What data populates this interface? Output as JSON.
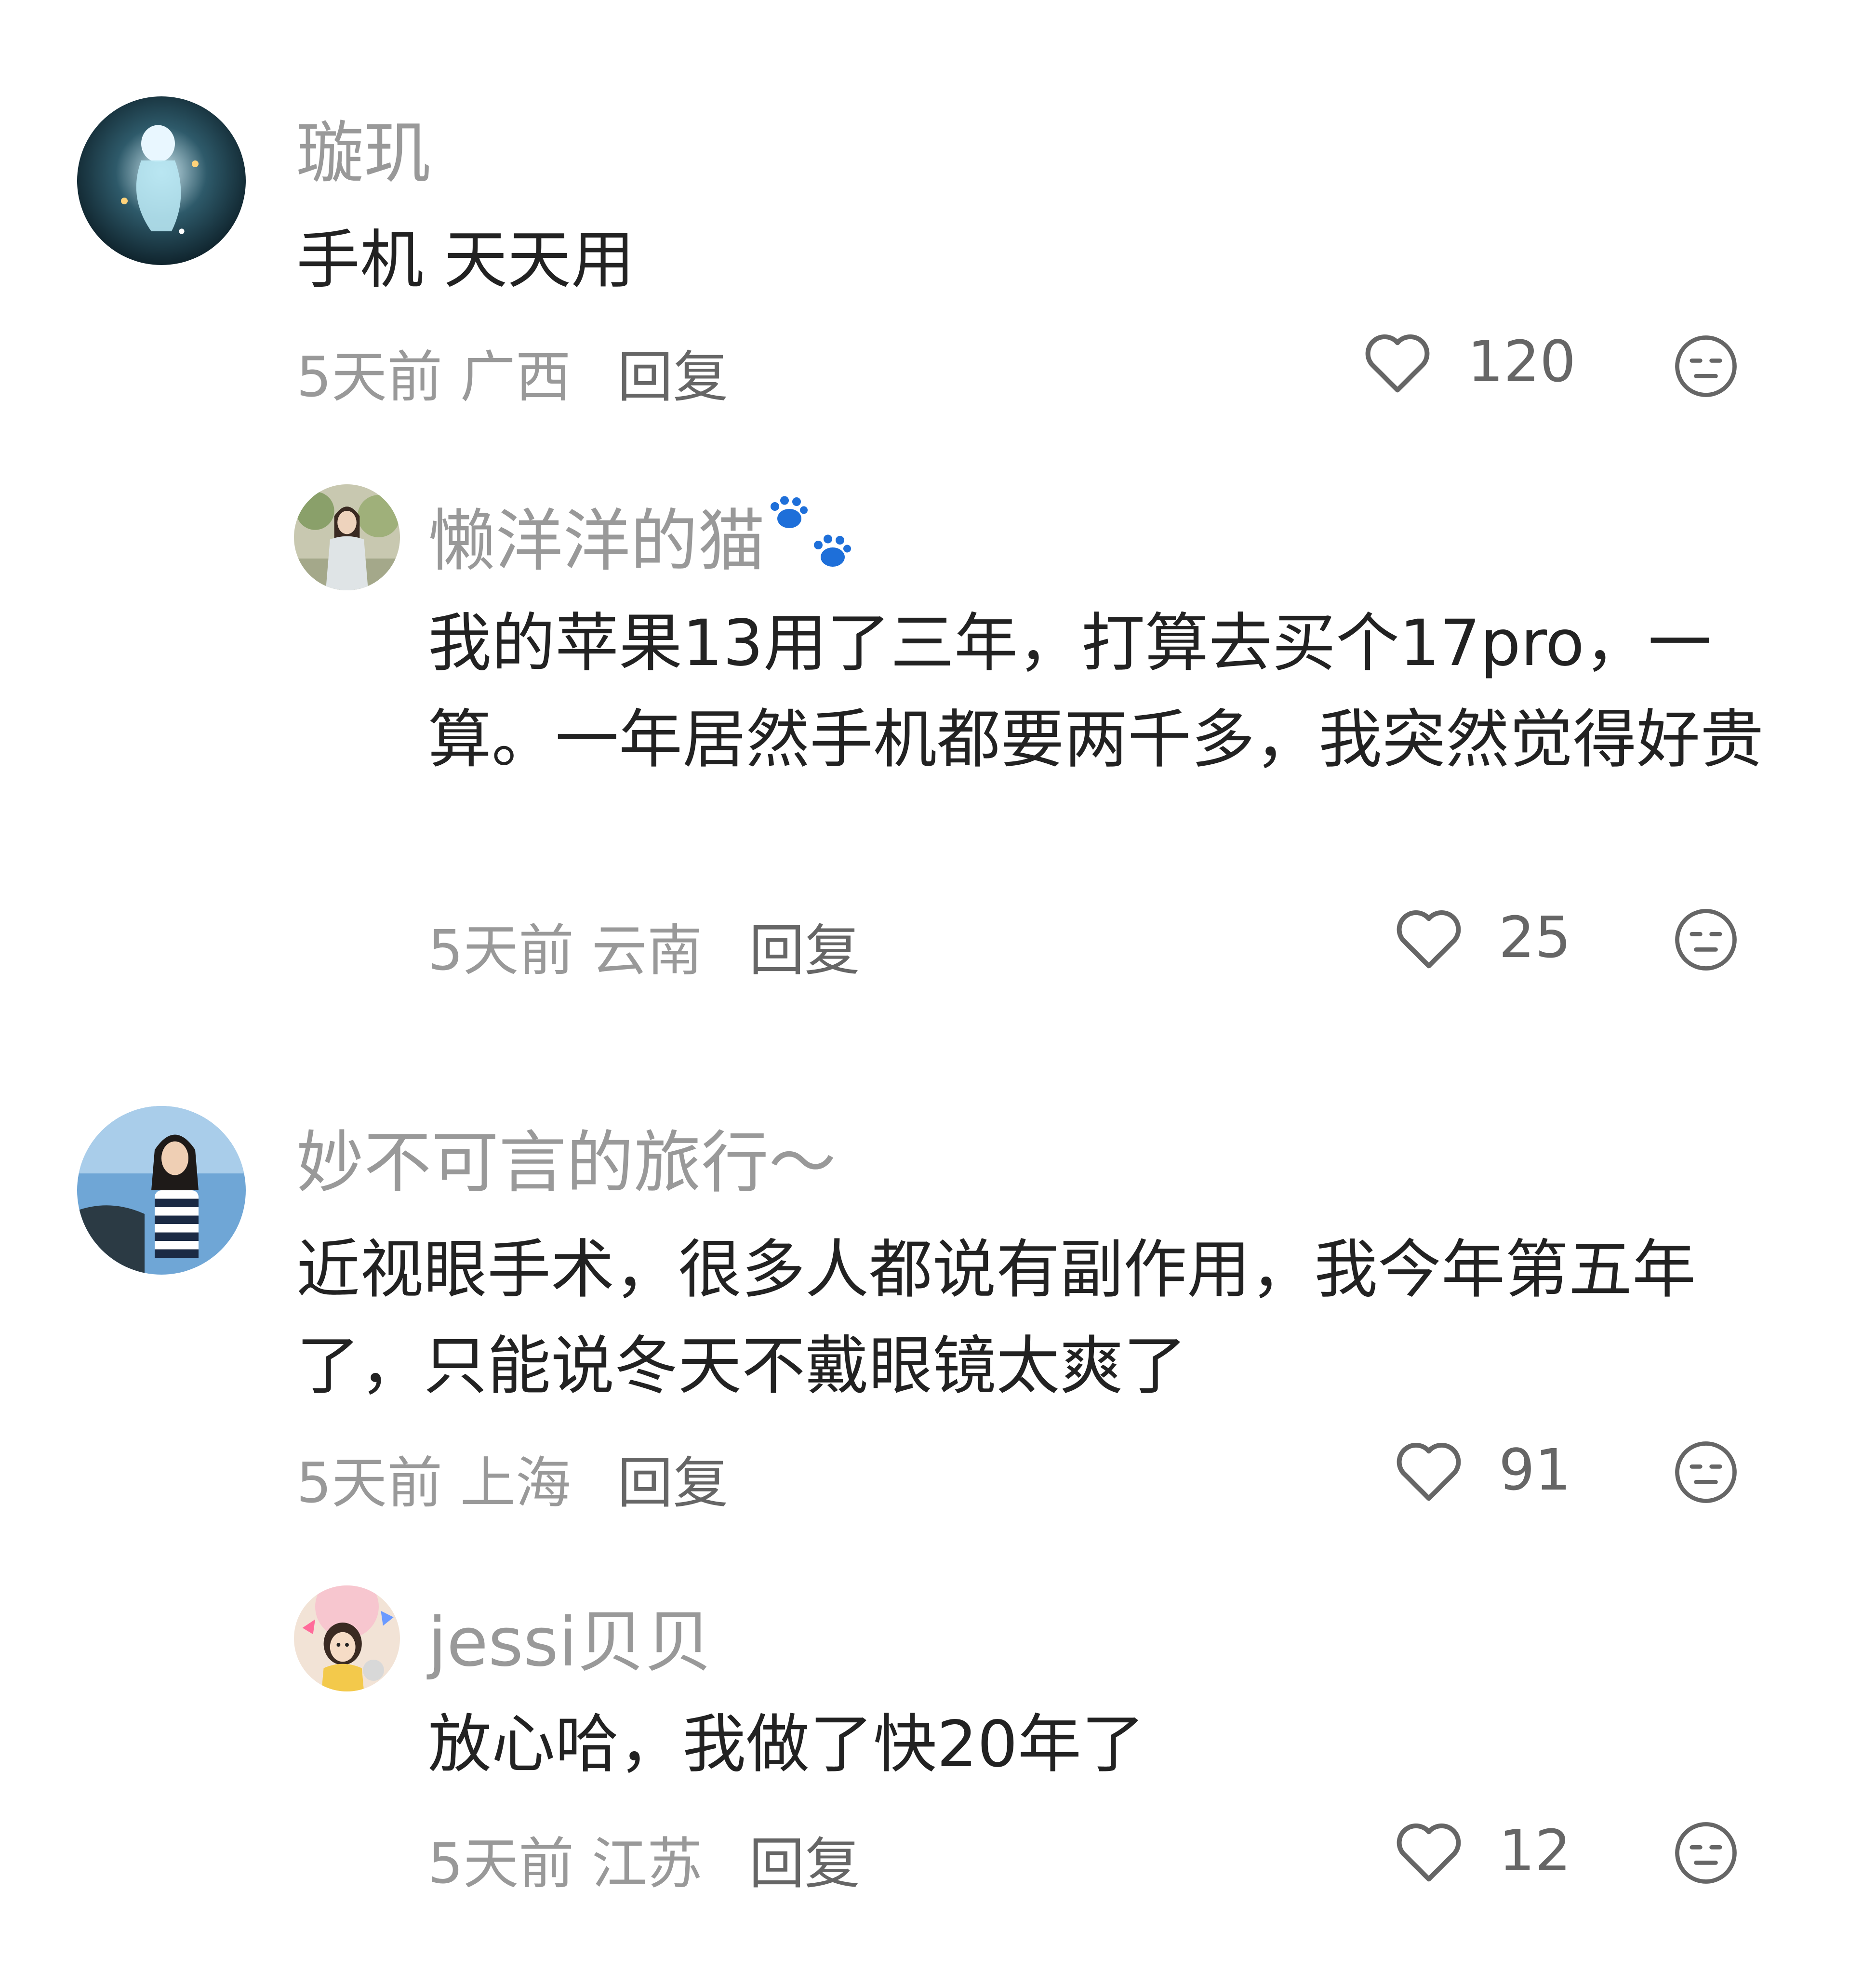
{
  "comments": [
    {
      "name": "璇玑",
      "text": "手机 天天用",
      "time": "5天前",
      "location": "广西",
      "reply_label": "回复",
      "likes": "120"
    },
    {
      "name": "懒洋洋的猫",
      "text": "我的苹果13用了三年，打算去买个17pro，一算。一年居然手机都要两千多，我突然觉得好贵",
      "time": "5天前",
      "location": "云南",
      "reply_label": "回复",
      "likes": "25"
    },
    {
      "name": "妙不可言的旅行～",
      "text": "近视眼手术，很多人都说有副作用，我今年第五年了，只能说冬天不戴眼镜太爽了",
      "time": "5天前",
      "location": "上海",
      "reply_label": "回复",
      "likes": "91"
    },
    {
      "name": "jessi贝贝",
      "text": "放心哈，我做了快20年了",
      "time": "5天前",
      "location": "江苏",
      "reply_label": "回复",
      "likes": "12"
    }
  ],
  "icons": {
    "like": "heart-outline-icon",
    "dislike": "neutral-face-icon",
    "paw": "paw-prints-icon"
  },
  "colors": {
    "name": "#999999",
    "text": "#222222",
    "meta": "#999999",
    "icon": "#666666",
    "paw": "#1e6fd9"
  }
}
